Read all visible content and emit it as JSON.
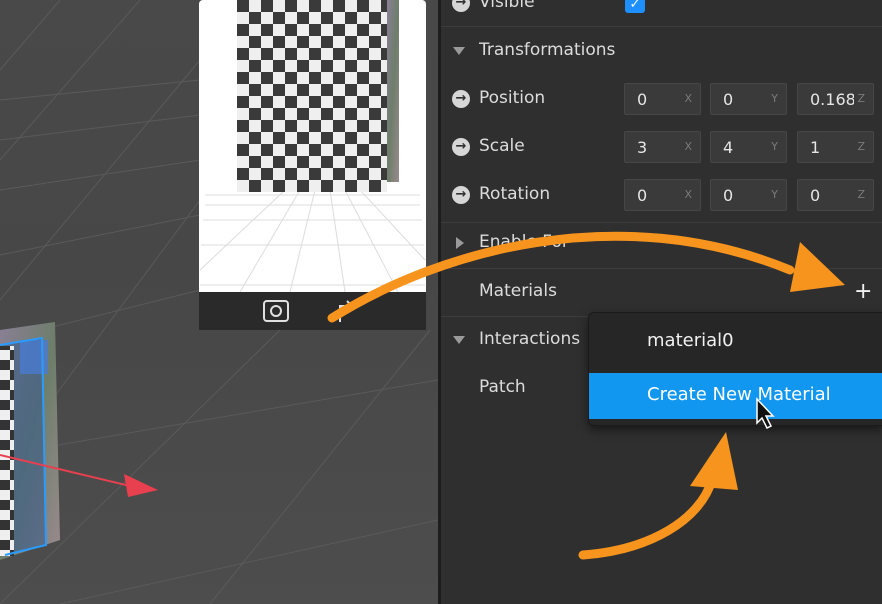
{
  "inspector": {
    "visible_label": "Visible",
    "transformations_label": "Transformations",
    "position": {
      "label": "Position",
      "x": "0",
      "y": "0",
      "z": "0.168",
      "x_axis": "X",
      "y_axis": "Y",
      "z_axis": "Z"
    },
    "scale": {
      "label": "Scale",
      "x": "3",
      "y": "4",
      "z": "1",
      "x_axis": "X",
      "y_axis": "Y",
      "z_axis": "Z"
    },
    "rotation": {
      "label": "Rotation",
      "x": "0",
      "y": "0",
      "z": "0",
      "x_axis": "X",
      "y_axis": "Y",
      "z_axis": "Z"
    },
    "enable_for_label": "Enable For",
    "materials_label": "Materials",
    "add_material_symbol": "+",
    "interactions_label": "Interactions",
    "patch_label": "Patch"
  },
  "dropdown": {
    "items": [
      "material0",
      "Create New Material"
    ],
    "selected": "Create New Material"
  },
  "colors": {
    "accent": "#1197f0",
    "annotation_arrow": "#f7941d",
    "axis_x": "#e8404f",
    "panel_bg": "#2f2f2f"
  },
  "icons": [
    "checkmark-icon",
    "arrow-right-circle-icon",
    "camera-flip-icon",
    "rotate-icon",
    "plus-icon",
    "mouse-cursor-icon"
  ]
}
